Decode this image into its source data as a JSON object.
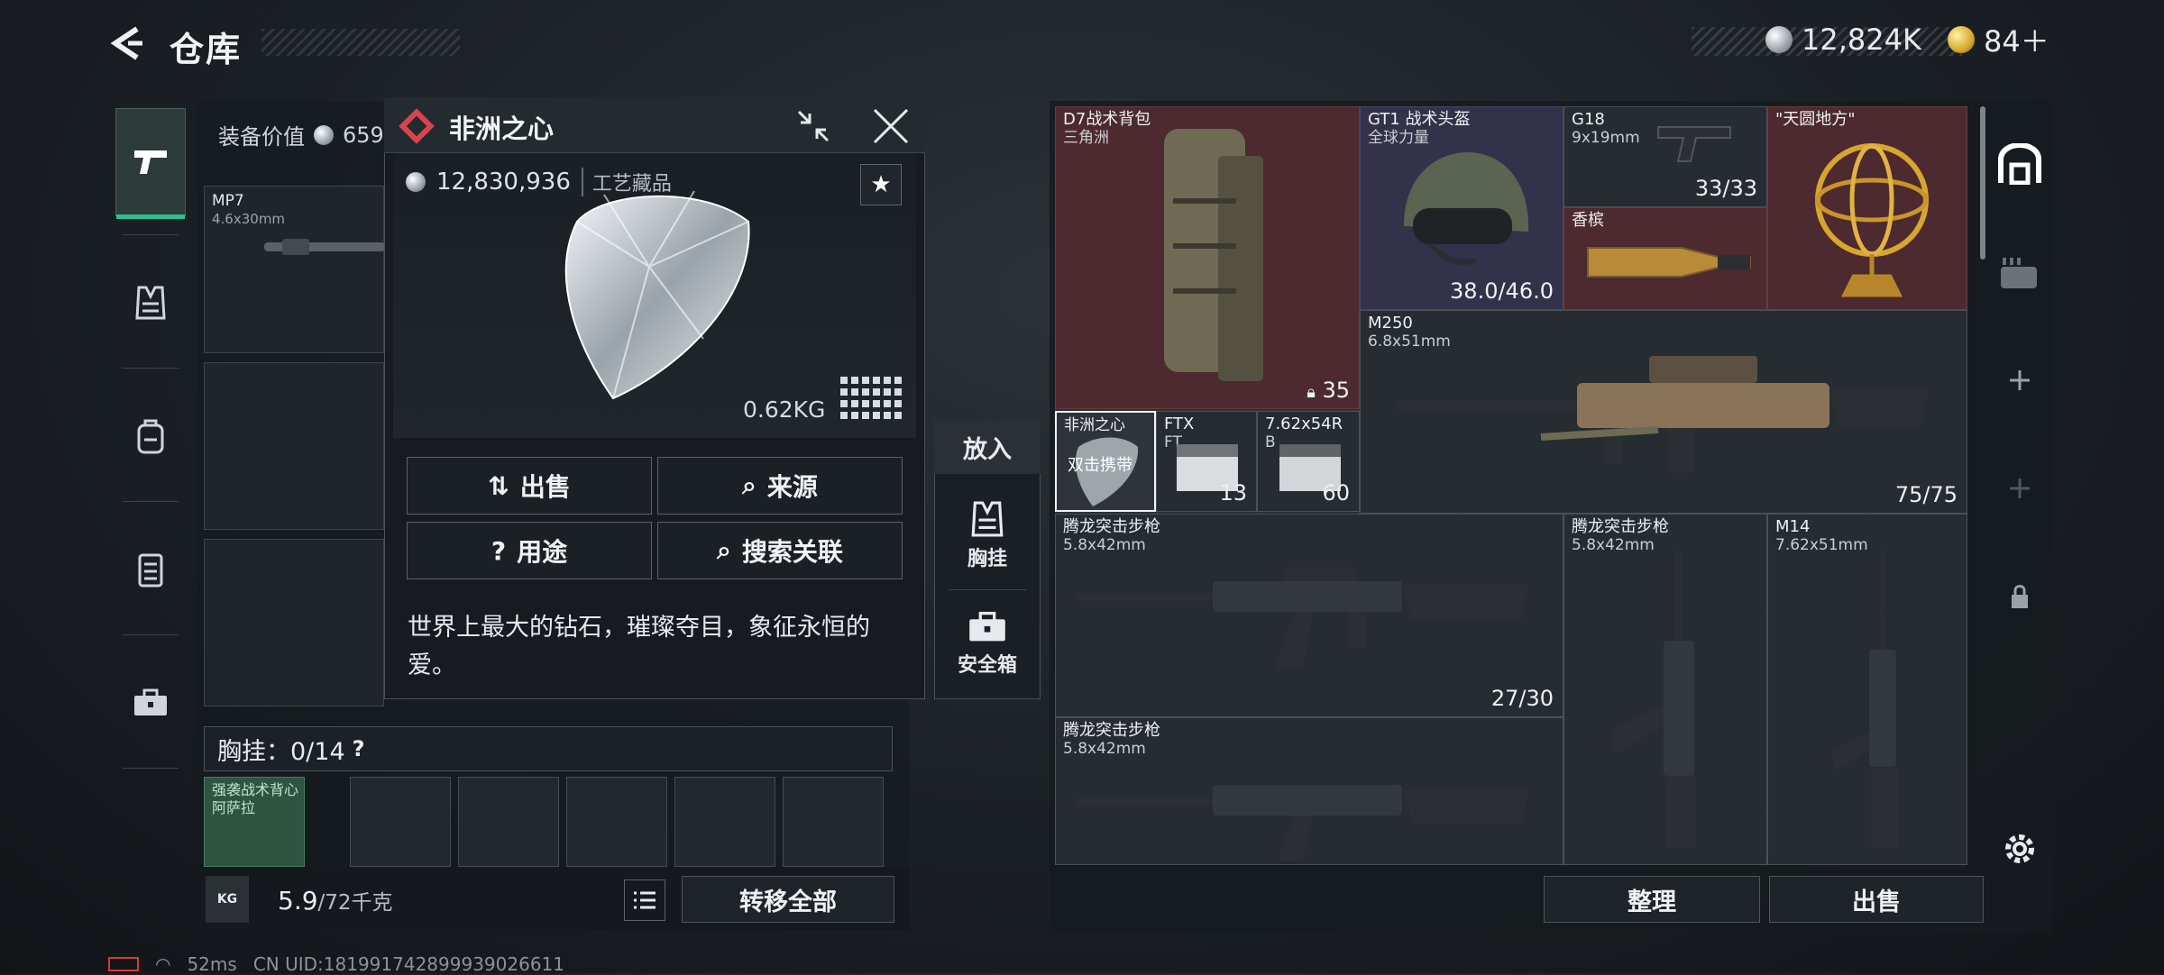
{
  "header": {
    "title": "仓库",
    "currency": [
      {
        "icon": "silver-coin-icon",
        "value": "12,824K"
      },
      {
        "icon": "gold-coin-icon",
        "value": "84＋"
      }
    ]
  },
  "categories": [
    "pistol-icon",
    "vest-icon",
    "backpack-icon",
    "armor-icon",
    "case-icon"
  ],
  "equipment": {
    "value_label": "装备价值",
    "value_partial": "659",
    "primary": {
      "name": "MP7",
      "caliber": "4.6x30mm"
    },
    "vest_label": "胸挂：0/14",
    "vest_help": "?",
    "vest_item": {
      "name": "强袭战术背心",
      "sub": "阿萨拉"
    },
    "weight_value": "5.9",
    "weight_cap": "/72千克",
    "kg_label": "KG",
    "transfer_all": "转移全部"
  },
  "popup": {
    "title": "非洲之心",
    "price": "12,830,936",
    "category": "工艺藏品",
    "weight": "0.62KG",
    "buttons": {
      "sell": "出售",
      "source": "来源",
      "usage": "用途",
      "search": "搜索关联"
    },
    "description": "世界上最大的钻石，璀璨夺目，象征永恒的爱。"
  },
  "put_into": {
    "title": "放入",
    "options": [
      {
        "label": "胸挂",
        "icon": "vest-icon"
      },
      {
        "label": "安全箱",
        "icon": "safebox-icon"
      }
    ]
  },
  "stash": {
    "items": [
      {
        "name": "D7战术背包",
        "sub": "三角洲",
        "count": "35",
        "rarity": "red"
      },
      {
        "name": "GT1 战术头盔",
        "sub": "全球力量",
        "count": "38.0/46.0",
        "rarity": "purple"
      },
      {
        "name": "G18",
        "sub": "9x19mm",
        "count": "33/33",
        "rarity": "normal"
      },
      {
        "name": "\"天圆地方\"",
        "sub": "",
        "count": "",
        "rarity": "red"
      },
      {
        "name": "香槟",
        "sub": "",
        "count": "",
        "rarity": "red"
      },
      {
        "name": "M250",
        "sub": "6.8x51mm",
        "count": "75/75",
        "rarity": "normal"
      },
      {
        "name": "非洲之心",
        "sub": "双击携带",
        "count": "",
        "rarity": "selected"
      },
      {
        "name": "FTX",
        "sub": "FT",
        "count": "13",
        "rarity": "normal"
      },
      {
        "name": "7.62x54R",
        "sub": "B",
        "count": "60",
        "rarity": "normal"
      },
      {
        "name": "腾龙突击步枪",
        "sub": "5.8x42mm",
        "count": "27/30",
        "rarity": "normal"
      },
      {
        "name": "腾龙突击步枪",
        "sub": "5.8x42mm",
        "count": "",
        "rarity": "normal"
      },
      {
        "name": "M14",
        "sub": "7.62x51mm",
        "count": "",
        "rarity": "normal"
      },
      {
        "name": "腾龙突击步枪",
        "sub": "5.8x42mm",
        "count": "",
        "rarity": "normal"
      }
    ],
    "sort_button": "整理",
    "sell_button": "出售"
  },
  "status": {
    "ping": "52ms",
    "uid": "CN UID:181991742899939026611"
  }
}
